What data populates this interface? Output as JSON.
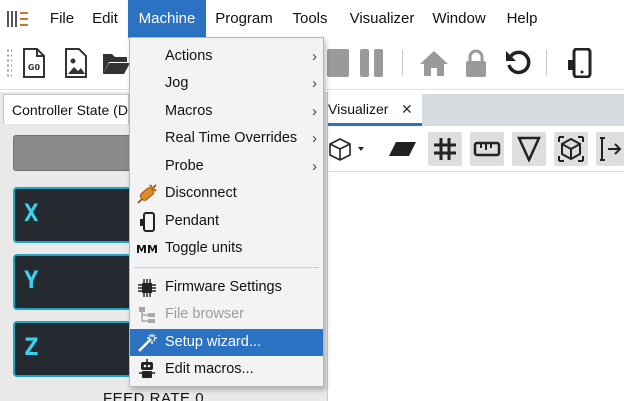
{
  "menubar": {
    "items": [
      "File",
      "Edit",
      "Machine",
      "Program",
      "Tools",
      "Visualizer",
      "Window",
      "Help"
    ],
    "active": "Machine"
  },
  "left_panel": {
    "tab_label": "Controller State (D",
    "axes": [
      "X",
      "Y",
      "Z"
    ],
    "feed_rate_label": "FEED RATE 0"
  },
  "visualizer": {
    "tab_label": "Visualizer",
    "close_glyph": "✕"
  },
  "machine_menu": {
    "items": [
      {
        "label": "Actions",
        "icon": "none",
        "submenu": true
      },
      {
        "label": "Jog",
        "icon": "none",
        "submenu": true
      },
      {
        "label": "Macros",
        "icon": "none",
        "submenu": true
      },
      {
        "label": "Real Time Overrides",
        "icon": "none",
        "submenu": true
      },
      {
        "label": "Probe",
        "icon": "none",
        "submenu": true
      },
      {
        "label": "Disconnect",
        "icon": "plug-icon"
      },
      {
        "label": "Pendant",
        "icon": "pendant-icon"
      },
      {
        "label": "Toggle units",
        "icon": "mm-icon",
        "icon_text": "MM"
      },
      {
        "label": "Firmware Settings",
        "icon": "chip-icon"
      },
      {
        "label": "File browser",
        "icon": "file-tree-icon",
        "disabled": true
      },
      {
        "label": "Setup wizard...",
        "icon": "wand-icon",
        "highlighted": true
      },
      {
        "label": "Edit macros...",
        "icon": "robot-icon"
      }
    ]
  },
  "colors": {
    "accent": "#2b72c2",
    "axis_text": "#3ad0ee",
    "axis_border": "#20a5c2",
    "axis_bg": "#242a2f",
    "plug_orange": "#e0892b"
  }
}
